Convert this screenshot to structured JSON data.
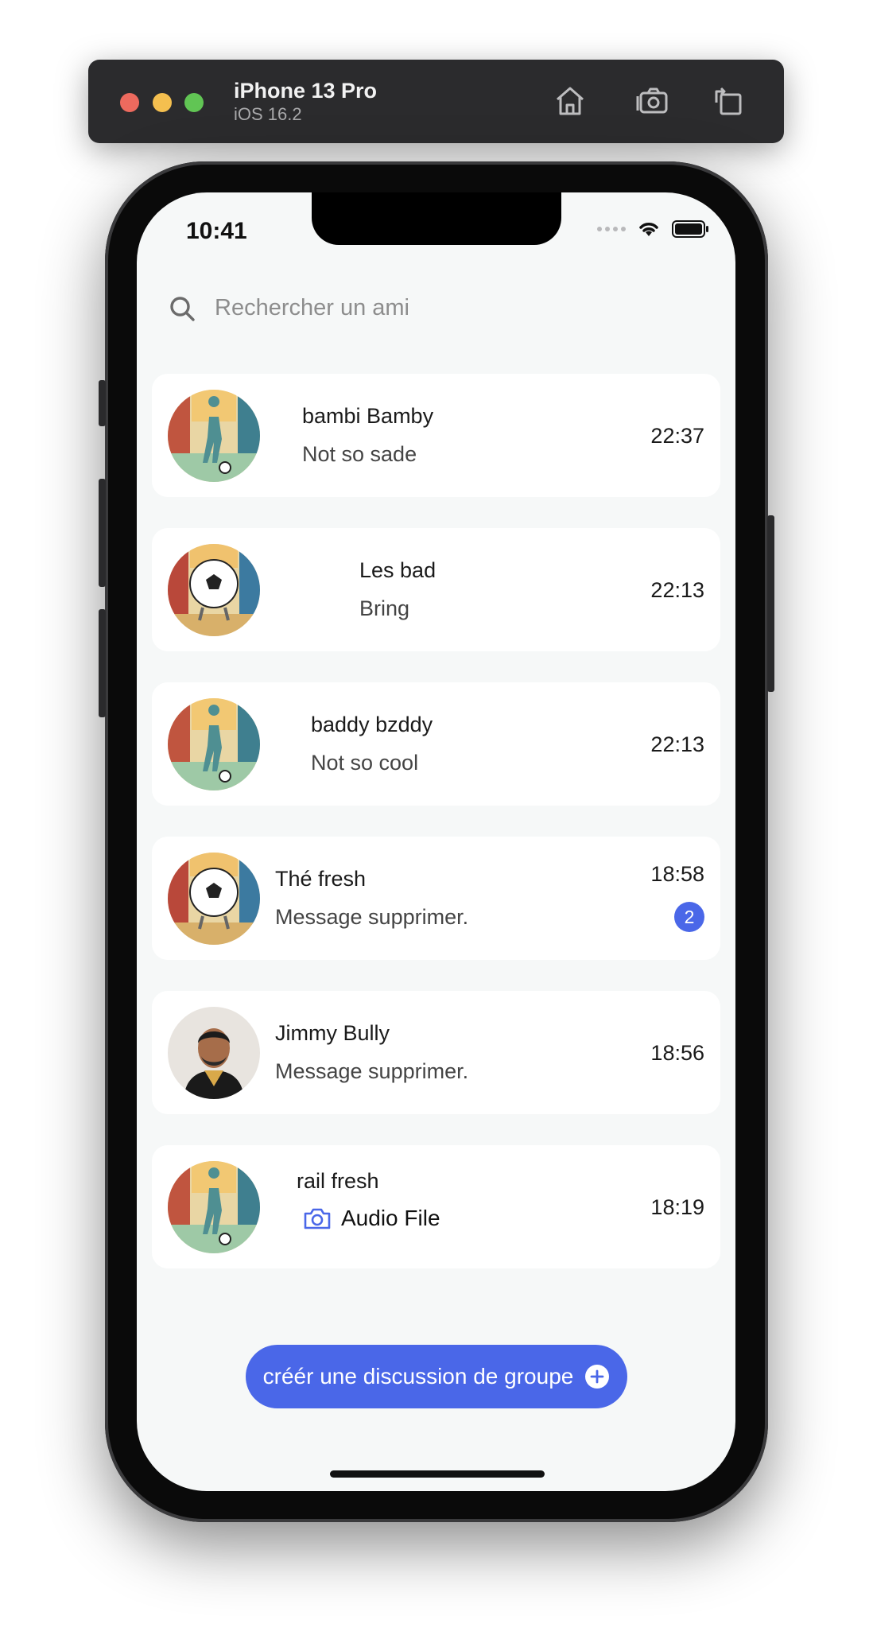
{
  "simulator": {
    "device": "iPhone 13 Pro",
    "os": "iOS 16.2",
    "toolbar_icons": [
      "home-icon",
      "screenshot-icon",
      "rotate-icon"
    ]
  },
  "status_bar": {
    "time": "10:41"
  },
  "search": {
    "placeholder": "Rechercher un ami"
  },
  "conversations": [
    {
      "name": "bambi Bamby",
      "message": "Not so sade",
      "time": "22:37",
      "avatar": "street-soccer-player"
    },
    {
      "name": "Les bad",
      "message": "Bring",
      "time": "22:13",
      "avatar": "street-soccer-ball"
    },
    {
      "name": "baddy bzddy",
      "message": "Not so cool",
      "time": "22:13",
      "avatar": "street-soccer-player"
    },
    {
      "name": "Thé fresh",
      "message": "Message supprimer.",
      "time": "18:58",
      "unread": "2",
      "avatar": "street-soccer-ball"
    },
    {
      "name": "Jimmy Bully",
      "message": "Message supprimer.",
      "time": "18:56",
      "avatar": "man-portrait"
    },
    {
      "name": "rail fresh",
      "message": "Audio File",
      "time": "18:19",
      "message_icon": "camera-icon",
      "avatar": "street-soccer-player"
    }
  ],
  "cta": {
    "label": "créér une discussion de groupe",
    "icon": "plus-circle-icon"
  },
  "colors": {
    "accent": "#4a67e8",
    "background": "#f6f8f8",
    "card": "#ffffff"
  }
}
